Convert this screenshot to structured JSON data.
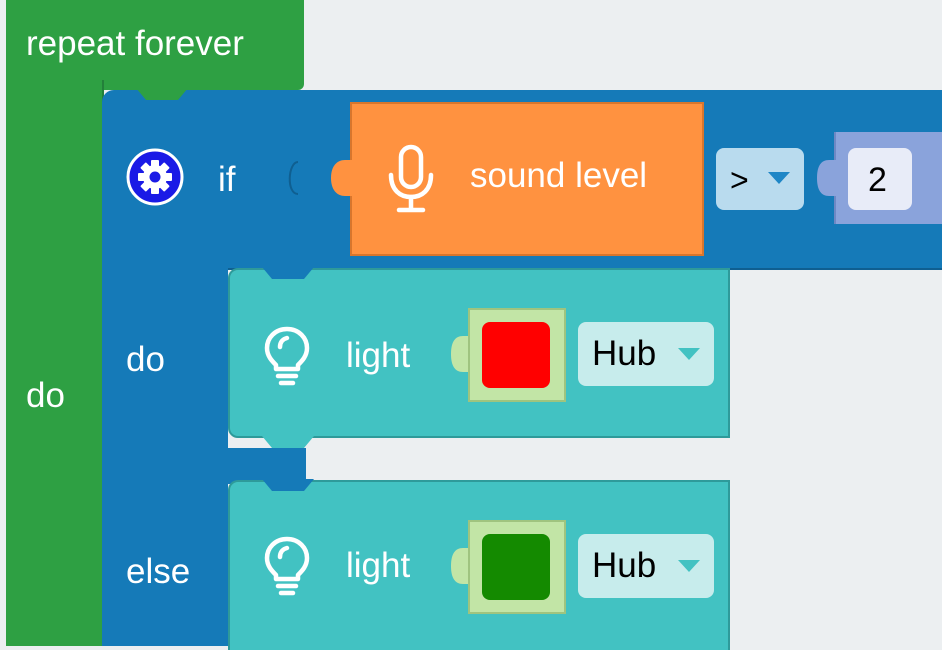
{
  "colors": {
    "workspace": "#eceff1",
    "loop_block": "#2ea043",
    "loop_block_dark": "#23803a",
    "if_block": "#157ab8",
    "if_block_dark": "#0f5f91",
    "sensor_block": "#ff9240",
    "sensor_block_dark": "#d8762d",
    "light_block": "#42c2c2",
    "light_block_dark": "#2e9a9a",
    "number_block": "#8aa3db",
    "dropdown_field": "#b9dbee",
    "hub_field": "#c7ecec",
    "color_swatch_bg": "#c2e5a6",
    "red_swatch": "#ff0000",
    "green_swatch": "#148a00"
  },
  "loop": {
    "label": "repeat forever",
    "do_label": "do"
  },
  "if_block": {
    "if_label": "if",
    "do_label": "do",
    "else_label": "else",
    "gear_icon": "gear-icon"
  },
  "condition": {
    "sensor_label": "sound level",
    "sensor_icon": "microphone-icon",
    "operator": ">",
    "operator_icon": "chevron-down-icon",
    "value": "2"
  },
  "do_action": {
    "label": "light",
    "icon": "lightbulb-icon",
    "color": "#ff0000",
    "target": "Hub"
  },
  "else_action": {
    "label": "light",
    "icon": "lightbulb-icon",
    "color": "#148a00",
    "target": "Hub"
  }
}
